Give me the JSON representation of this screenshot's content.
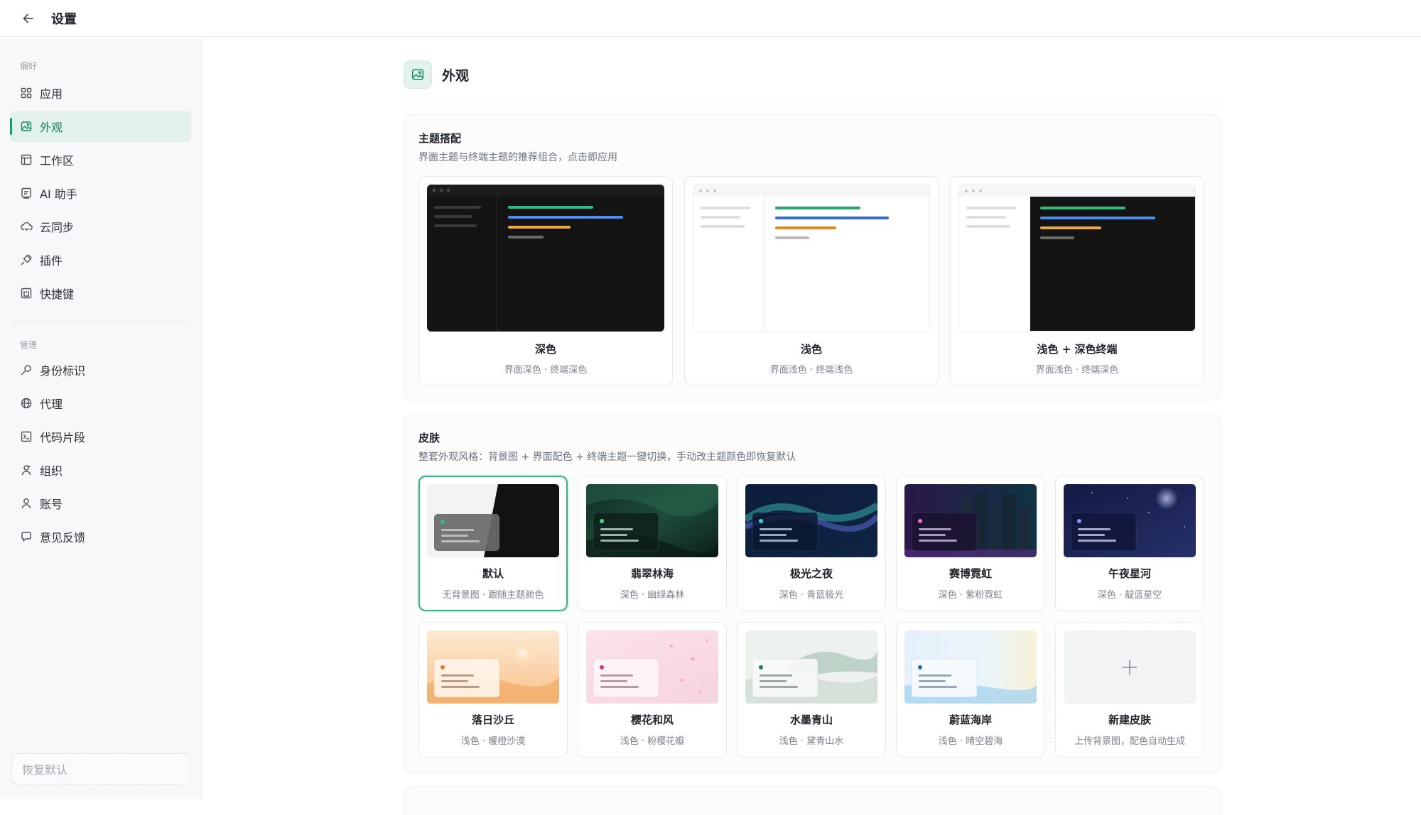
{
  "titlebar": {
    "title": "设置"
  },
  "sidebar": {
    "section_prefs": "偏好",
    "section_manage": "管理",
    "items": [
      {
        "label": "应用",
        "icon": "grid-icon"
      },
      {
        "label": "外观",
        "icon": "image-icon",
        "active": true
      },
      {
        "label": "工作区",
        "icon": "layout-icon"
      },
      {
        "label": "AI 助手",
        "icon": "ai-icon"
      },
      {
        "label": "云同步",
        "icon": "cloud-sync-icon"
      },
      {
        "label": "插件",
        "icon": "plug-icon"
      },
      {
        "label": "快捷键",
        "icon": "keyboard-icon"
      },
      {
        "label": "身份标识",
        "icon": "key-icon"
      },
      {
        "label": "代理",
        "icon": "globe-icon"
      },
      {
        "label": "代码片段",
        "icon": "terminal-icon"
      },
      {
        "label": "组织",
        "icon": "organization-icon"
      },
      {
        "label": "账号",
        "icon": "user-icon"
      },
      {
        "label": "意见反馈",
        "icon": "feedback-icon"
      }
    ],
    "restore_label": "恢复默认"
  },
  "main": {
    "title": "外观",
    "themes": {
      "title": "主题搭配",
      "desc": "界面主题与终端主题的推荐组合，点击即应用",
      "cards": [
        {
          "name": "深色",
          "sub": "界面深色 · 终端深色"
        },
        {
          "name": "浅色",
          "sub": "界面浅色 · 终端浅色"
        },
        {
          "name": "浅色 + 深色终端",
          "sub": "界面浅色 · 终端深色"
        }
      ]
    },
    "skins": {
      "title": "皮肤",
      "desc": "整套外观风格：背景图 + 界面配色 + 终端主题一键切换，手动改主题颜色即恢复默认",
      "cards": [
        {
          "name": "默认",
          "sub": "无背景图 · 跟随主题颜色",
          "selected": true
        },
        {
          "name": "翡翠林海",
          "sub": "深色 · 幽绿森林"
        },
        {
          "name": "极光之夜",
          "sub": "深色 · 青蓝极光"
        },
        {
          "name": "赛博霓虹",
          "sub": "深色 · 紫粉霓虹"
        },
        {
          "name": "午夜星河",
          "sub": "深色 · 靛蓝星空"
        },
        {
          "name": "落日沙丘",
          "sub": "浅色 · 暖橙沙漠"
        },
        {
          "name": "樱花和风",
          "sub": "浅色 · 粉樱花瓣"
        },
        {
          "name": "水墨青山",
          "sub": "浅色 · 黛青山水"
        },
        {
          "name": "蔚蓝海岸",
          "sub": "浅色 · 晴空碧海"
        },
        {
          "name": "新建皮肤",
          "sub": "上传背景图，配色自动生成"
        }
      ]
    }
  },
  "colors": {
    "accent": "#17a06a",
    "active_bg": "#e2f1ea"
  }
}
